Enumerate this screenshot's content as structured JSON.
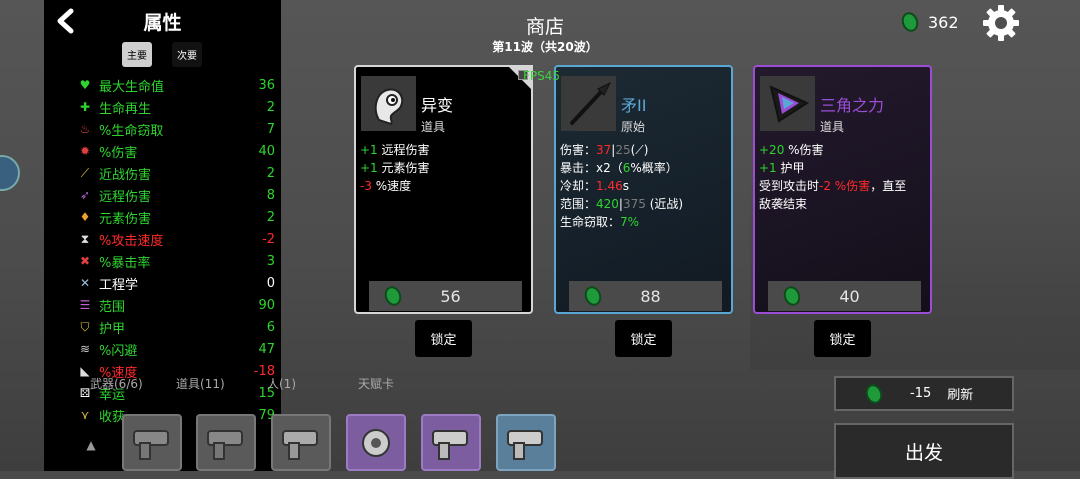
{
  "header": {
    "title": "商店",
    "wave": "第11波（共20波）",
    "currency": "362",
    "fps": "FPS45"
  },
  "stats_panel": {
    "title": "属性",
    "tabs": [
      "主要",
      "次要"
    ],
    "rows": [
      {
        "icon": "heart-icon",
        "name": "最大生命值",
        "value": "36",
        "color": "green"
      },
      {
        "icon": "regen-icon",
        "name": "生命再生",
        "value": "2",
        "color": "green"
      },
      {
        "icon": "lifesteal-icon",
        "name": "%生命窃取",
        "value": "7",
        "color": "green"
      },
      {
        "icon": "damage-icon",
        "name": "%伤害",
        "value": "40",
        "color": "green"
      },
      {
        "icon": "sword-icon",
        "name": "近战伤害",
        "value": "2",
        "color": "green"
      },
      {
        "icon": "bow-icon",
        "name": "远程伤害",
        "value": "8",
        "color": "green"
      },
      {
        "icon": "flame-icon",
        "name": "元素伤害",
        "value": "2",
        "color": "green"
      },
      {
        "icon": "hourglass-icon",
        "name": "%攻击速度",
        "value": "-2",
        "color": "red"
      },
      {
        "icon": "crit-icon",
        "name": "%暴击率",
        "value": "3",
        "color": "green"
      },
      {
        "icon": "wrench-icon",
        "name": "工程学",
        "value": "0",
        "color": "white"
      },
      {
        "icon": "range-icon",
        "name": "范围",
        "value": "90",
        "color": "green"
      },
      {
        "icon": "shield-icon",
        "name": "护甲",
        "value": "6",
        "color": "green"
      },
      {
        "icon": "dodge-icon",
        "name": "%闪避",
        "value": "47",
        "color": "green"
      },
      {
        "icon": "boot-icon",
        "name": "%速度",
        "value": "-18",
        "color": "red"
      },
      {
        "icon": "dice-icon",
        "name": "幸运",
        "value": "15",
        "color": "green"
      },
      {
        "icon": "harvest-icon",
        "name": "收获",
        "value": "79",
        "color": "green"
      }
    ]
  },
  "cards": [
    {
      "name": "异变",
      "type": "道具",
      "price": "56",
      "lock_label": "锁定",
      "lines": [
        [
          {
            "t": "+1",
            "c": "green"
          },
          {
            "t": " 远程伤害",
            "c": "white"
          }
        ],
        [
          {
            "t": "+1",
            "c": "green"
          },
          {
            "t": " 元素伤害",
            "c": "white"
          }
        ],
        [
          {
            "t": "-3",
            "c": "red"
          },
          {
            "t": " %速度",
            "c": "white"
          }
        ]
      ]
    },
    {
      "name": "矛II",
      "type": "原始",
      "price": "88",
      "lock_label": "锁定",
      "lines": [
        [
          {
            "t": "伤害：",
            "c": "white"
          },
          {
            "t": "37",
            "c": "red"
          },
          {
            "t": "|",
            "c": "white"
          },
          {
            "t": "25",
            "c": "grey"
          },
          {
            "t": "(⟋)",
            "c": "white"
          }
        ],
        [
          {
            "t": "暴击：x2（",
            "c": "white"
          },
          {
            "t": "6",
            "c": "green"
          },
          {
            "t": "%概率）",
            "c": "white"
          }
        ],
        [
          {
            "t": "冷却：",
            "c": "white"
          },
          {
            "t": "1.46",
            "c": "red"
          },
          {
            "t": "s",
            "c": "white"
          }
        ],
        [
          {
            "t": "范围：",
            "c": "white"
          },
          {
            "t": "420",
            "c": "green"
          },
          {
            "t": "|",
            "c": "white"
          },
          {
            "t": "375",
            "c": "grey"
          },
          {
            "t": " (近战)",
            "c": "white"
          }
        ],
        [
          {
            "t": "生命窃取：",
            "c": "white"
          },
          {
            "t": "7%",
            "c": "green"
          }
        ]
      ]
    },
    {
      "name": "三角之力",
      "type": "道具",
      "price": "40",
      "lock_label": "锁定",
      "lines": [
        [
          {
            "t": "+20",
            "c": "green"
          },
          {
            "t": " %伤害",
            "c": "white"
          }
        ],
        [
          {
            "t": "+1",
            "c": "green"
          },
          {
            "t": " 护甲",
            "c": "white"
          }
        ],
        [
          {
            "t": "受到攻击时",
            "c": "white"
          },
          {
            "t": "-2 %伤害",
            "c": "red"
          },
          {
            "t": "，直至",
            "c": "white"
          }
        ],
        [
          {
            "t": "敌袭结束",
            "c": "white"
          }
        ]
      ]
    }
  ],
  "bottom": {
    "tabs": [
      "武器(6/6)",
      "道具(11)",
      "人(1)",
      "天赋卡"
    ],
    "refresh_cost": "-15",
    "refresh_label": "刷新",
    "depart_label": "出发"
  },
  "colors": {
    "green": "#2ed52e",
    "red": "#ff2a2a",
    "grey": "#7a7a7a",
    "white": "#ffffff",
    "card2_border": "#5aa7d6",
    "card3_border": "#9b4dd6",
    "card3_name": "#9b4dd6",
    "card2_name": "#5aa7d6"
  }
}
